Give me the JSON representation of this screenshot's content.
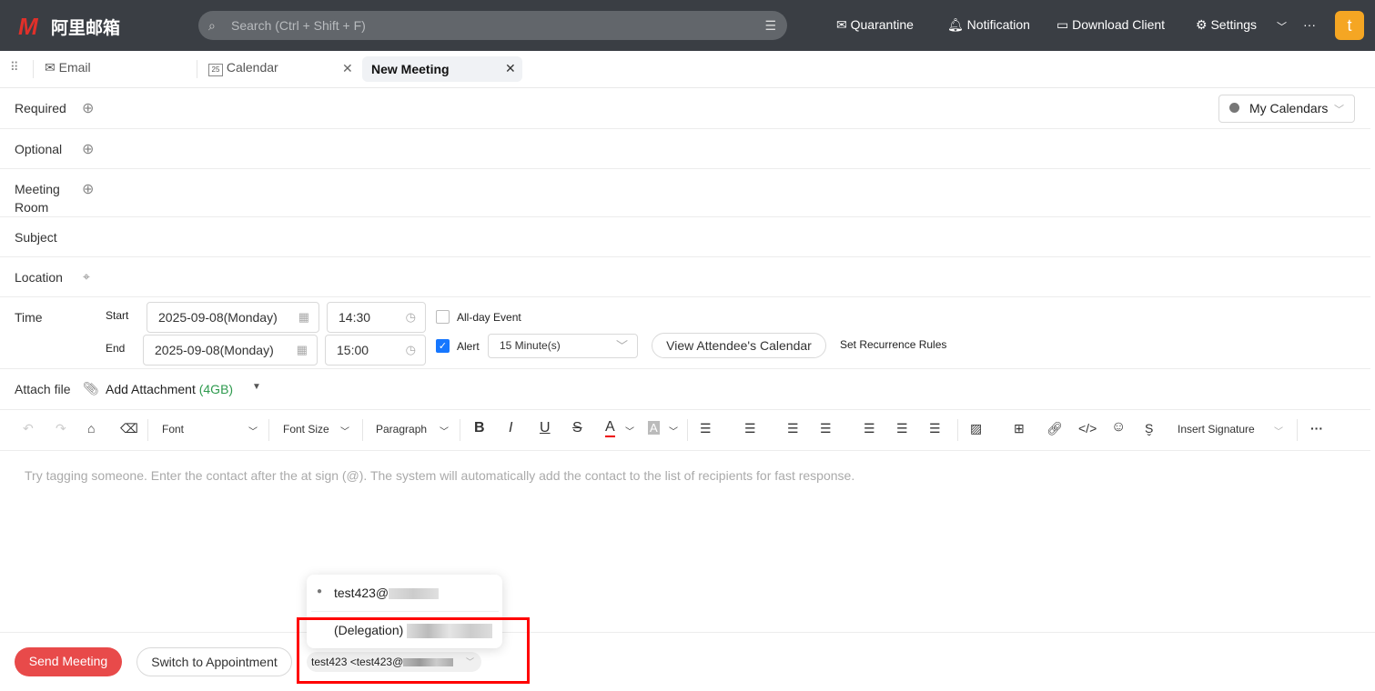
{
  "app": {
    "logo_mark": "M",
    "logo_text": "阿里邮箱"
  },
  "search": {
    "placeholder": "Search (Ctrl + Shift + F)"
  },
  "topnav": {
    "quarantine": "Quarantine",
    "notification": "Notification",
    "download": "Download Client",
    "settings": "Settings",
    "more": "···",
    "avatar": "t"
  },
  "tabs": [
    {
      "label": "Email"
    },
    {
      "label": "Calendar"
    },
    {
      "label": "New Meeting"
    }
  ],
  "calendar_day": "25",
  "form": {
    "required": "Required",
    "optional": "Optional",
    "room_line1": "Meeting",
    "room_line2": "Room",
    "subject": "Subject",
    "location": "Location",
    "time": "Time",
    "start": "Start",
    "end": "End",
    "start_date": "2025-09-08(Monday)",
    "start_time": "14:30",
    "end_date": "2025-09-08(Monday)",
    "end_time": "15:00",
    "allday": "All-day Event",
    "alert": "Alert",
    "alert_value": "15 Minute(s)",
    "view_attendee": "View Attendee's Calendar",
    "recurrence": "Set Recurrence Rules",
    "my_calendars": "My Calendars",
    "attach": "Attach file",
    "add_attachment": "Add Attachment",
    "attach_size": "(4GB)"
  },
  "toolbar": {
    "font": "Font",
    "font_size": "Font Size",
    "paragraph": "Paragraph",
    "signature": "Insert Signature",
    "more": "···"
  },
  "editor": {
    "placeholder": "Try tagging someone. Enter the contact after the at sign (@). The system will automatically add the contact to the list of recipients for fast response."
  },
  "footer": {
    "send": "Send Meeting",
    "switch": "Switch to Appointment",
    "sender": "test423 <test423@"
  },
  "dropdown": {
    "item1": "test423@",
    "item2": "(Delegation)"
  },
  "colors": {
    "accent": "#e84a4a",
    "highlight": "#ff0000",
    "avatar": "#f5a623"
  }
}
